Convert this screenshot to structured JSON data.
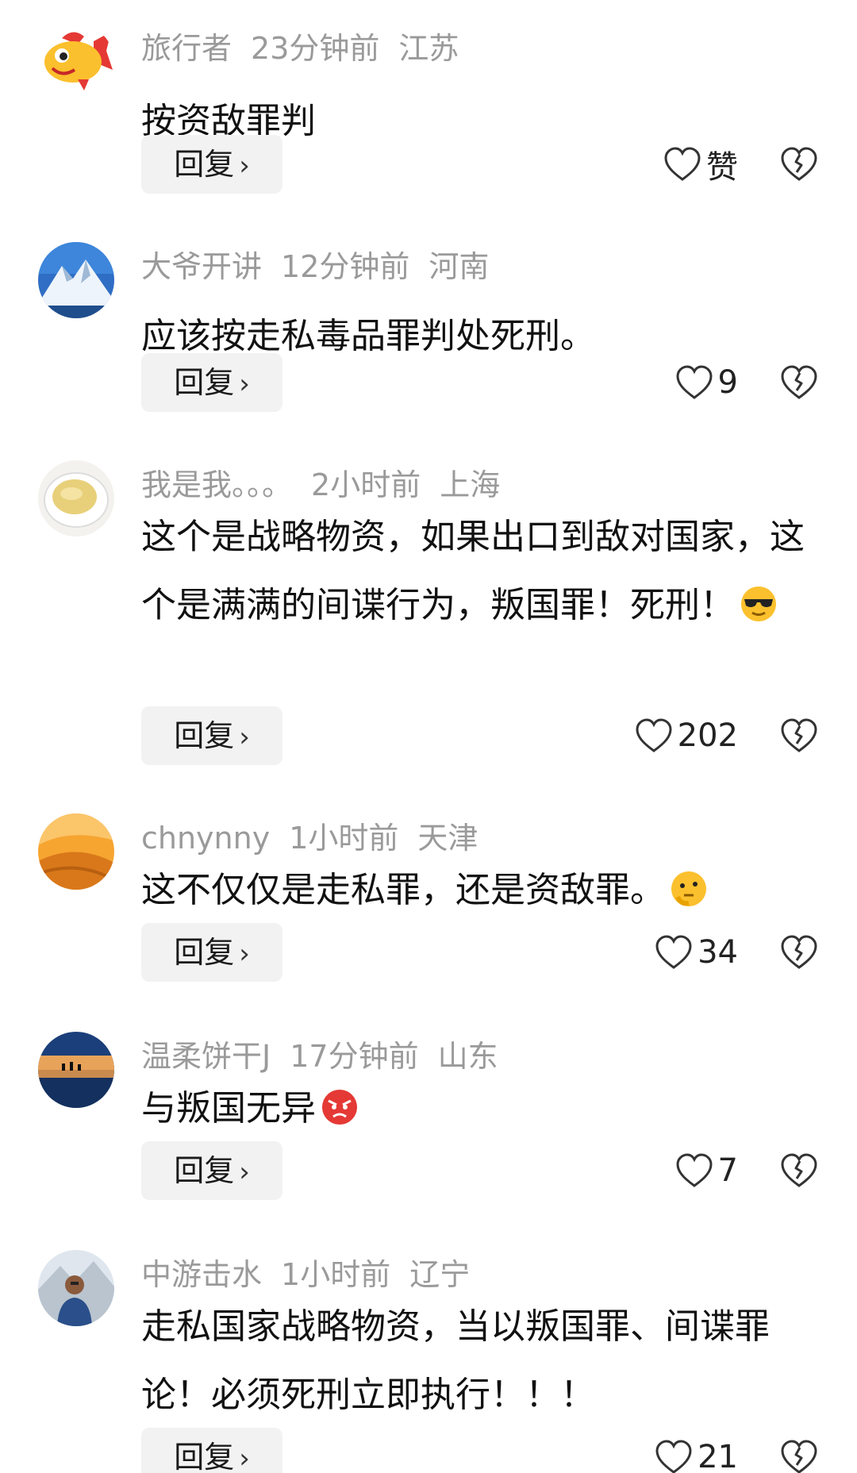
{
  "comments": [
    {
      "username": "旅行者",
      "time": "23分钟前",
      "location": "江苏",
      "text": "按资敌罪判",
      "reply_label": "回复",
      "reply_chevron": "›",
      "like_count": "赞",
      "avatar_icon": "cartoon-fish-avatar"
    },
    {
      "username": "大爷开讲",
      "time": "12分钟前",
      "location": "河南",
      "text": "应该按走私毒品罪判处死刑。",
      "reply_label": "回复",
      "reply_chevron": "›",
      "like_count": "9",
      "avatar_icon": "snowy-mountain-avatar"
    },
    {
      "username": "我是我。。。",
      "time": "2小时前",
      "location": "上海",
      "text": "这个是战略物资，如果出口到敌对国家，这个是满满的间谍行为，叛国罪！死刑！",
      "emoji": "sunglasses-emoji",
      "reply_label": "回复",
      "reply_chevron": "›",
      "like_count": "202",
      "avatar_icon": "tea-cup-avatar"
    },
    {
      "username": "chnynny",
      "time": "1小时前",
      "location": "天津",
      "text": "这不仅仅是走私罪，还是资敌罪。",
      "emoji": "thinking-emoji",
      "reply_label": "回复",
      "reply_chevron": "›",
      "like_count": "34",
      "avatar_icon": "desert-dune-avatar"
    },
    {
      "username": "温柔饼干J",
      "time": "17分钟前",
      "location": "山东",
      "text": "与叛国无异",
      "emoji": "angry-face-emoji",
      "reply_label": "回复",
      "reply_chevron": "›",
      "like_count": "7",
      "avatar_icon": "lake-sunset-avatar"
    },
    {
      "username": "中游击水",
      "time": "1小时前",
      "location": "辽宁",
      "text": "走私国家战略物资，当以叛国罪、间谍罪论！必须死刑立即执行！！！",
      "reply_label": "回复",
      "reply_chevron": "›",
      "like_count": "21",
      "avatar_icon": "person-mountain-avatar"
    }
  ],
  "colors": {
    "meta_gray": "#9a9a9a",
    "text": "#111111",
    "reply_bg": "#f2f2f2"
  }
}
